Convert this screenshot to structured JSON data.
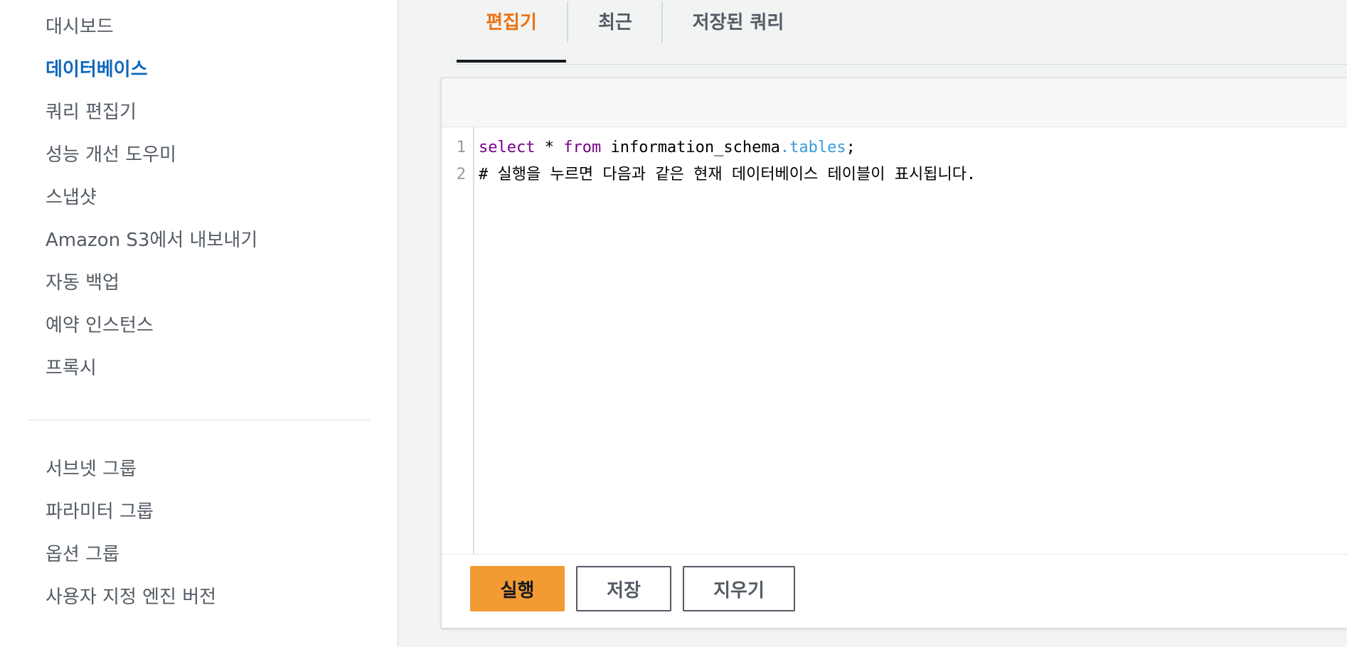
{
  "sidebar": {
    "items": [
      {
        "label": "대시보드"
      },
      {
        "label": "데이터베이스"
      },
      {
        "label": "쿼리 편집기"
      },
      {
        "label": "성능 개선 도우미"
      },
      {
        "label": "스냅샷"
      },
      {
        "label": "Amazon S3에서 내보내기"
      },
      {
        "label": "자동 백업"
      },
      {
        "label": "예약 인스턴스"
      },
      {
        "label": "프록시"
      }
    ],
    "items2": [
      {
        "label": "서브넷 그룹"
      },
      {
        "label": "파라미터 그룹"
      },
      {
        "label": "옵션 그룹"
      },
      {
        "label": "사용자 지정 엔진 버전"
      }
    ],
    "active": "데이터베이스"
  },
  "tabs": [
    {
      "label": "편집기",
      "active": true
    },
    {
      "label": "최근",
      "active": false
    },
    {
      "label": "저장된 쿼리",
      "active": false
    }
  ],
  "editor": {
    "line_numbers": [
      "1",
      "2"
    ],
    "line1": {
      "kw_select": "select",
      "star": " * ",
      "kw_from": "from",
      "schema": " information_schema",
      "prop_tables": ".tables",
      "semicolon": ";"
    },
    "line2": "# 실행을 누르면 다음과 같은 현재 데이터베이스 테이블이 표시됩니다."
  },
  "buttons": {
    "run": "실행",
    "save": "저장",
    "clear": "지우기"
  },
  "colors": {
    "accent_orange": "#ec7211",
    "active_nav_blue": "#1066bb",
    "run_button": "#f29b32"
  }
}
